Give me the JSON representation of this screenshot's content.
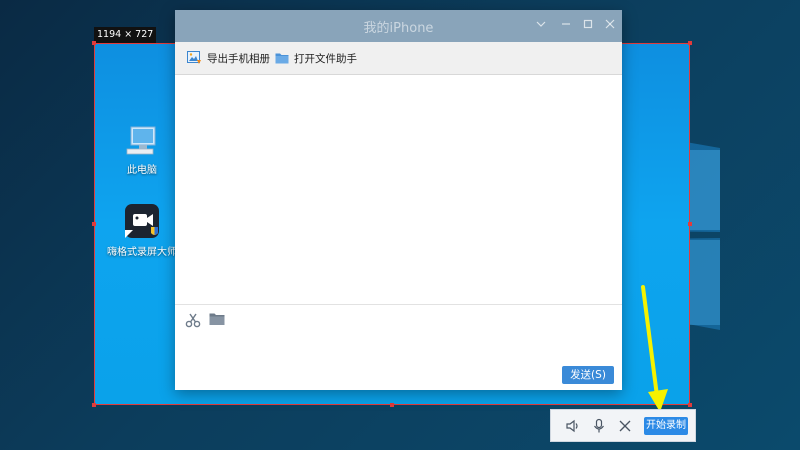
{
  "capture": {
    "size_label": "1194 × 727"
  },
  "desktop": {
    "icons": [
      {
        "label": "此电脑",
        "icon": "computer-icon"
      },
      {
        "label": "嗨格式录屏大师",
        "icon": "screen-recorder-app-icon"
      }
    ]
  },
  "window": {
    "title": "我的iPhone",
    "controls": [
      "chevron-down-icon",
      "minimize-icon",
      "maximize-icon",
      "close-icon"
    ],
    "toolbar": {
      "export_photos": "导出手机相册",
      "open_file_assistant": "打开文件助手"
    },
    "input_tools": [
      "scissors-icon",
      "folder-icon"
    ],
    "send_label": "发送(S)"
  },
  "record_bar": {
    "icons": [
      "speaker-icon",
      "microphone-icon",
      "close-icon"
    ],
    "start_label": "开始录制"
  },
  "colors": {
    "accent": "#2c8ae6",
    "selection_border": "#e23b3b",
    "annotation_arrow": "#f5f200"
  }
}
